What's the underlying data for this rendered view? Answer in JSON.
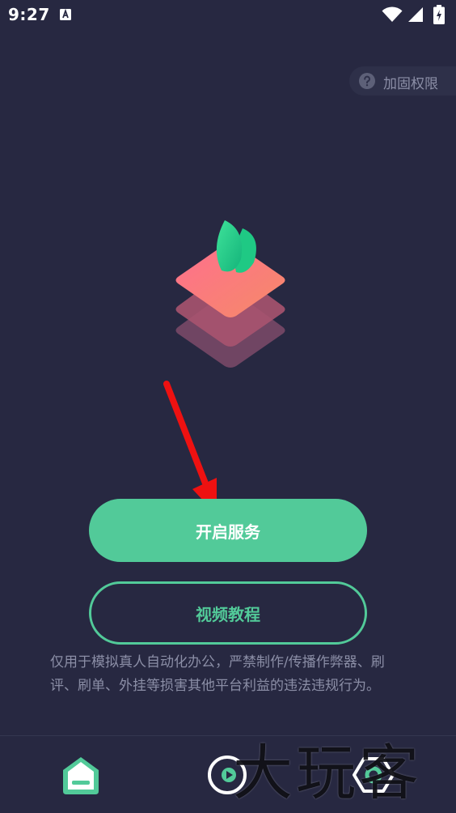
{
  "status_bar": {
    "time": "9:27",
    "notification_icon": "a-box-icon",
    "wifi_icon": "wifi-icon",
    "signal_icon": "signal-icon",
    "battery_icon": "battery-charging-icon"
  },
  "permission_chip": {
    "icon": "question-circle-icon",
    "label": "加固权限"
  },
  "logo": {
    "icon": "layered-diamond-leaf-icon"
  },
  "annotation": {
    "icon": "red-arrow-icon",
    "color": "#ee1111"
  },
  "buttons": {
    "primary_label": "开启服务",
    "secondary_label": "视频教程"
  },
  "disclaimer": "仅用于模拟真人自动化办公，严禁制作/传播作弊器、刷评、刷单、外挂等损害其他平台利益的违法违规行为。",
  "bottom_nav": {
    "items": [
      {
        "icon": "home-icon",
        "active": true
      },
      {
        "icon": "play-circle-icon",
        "active": false
      },
      {
        "icon": "hexagon-settings-icon",
        "active": false
      }
    ]
  },
  "watermark": {
    "text": "大玩客"
  },
  "colors": {
    "background": "#272841",
    "accent": "#52ca99",
    "muted_text": "#8b8ea6"
  }
}
